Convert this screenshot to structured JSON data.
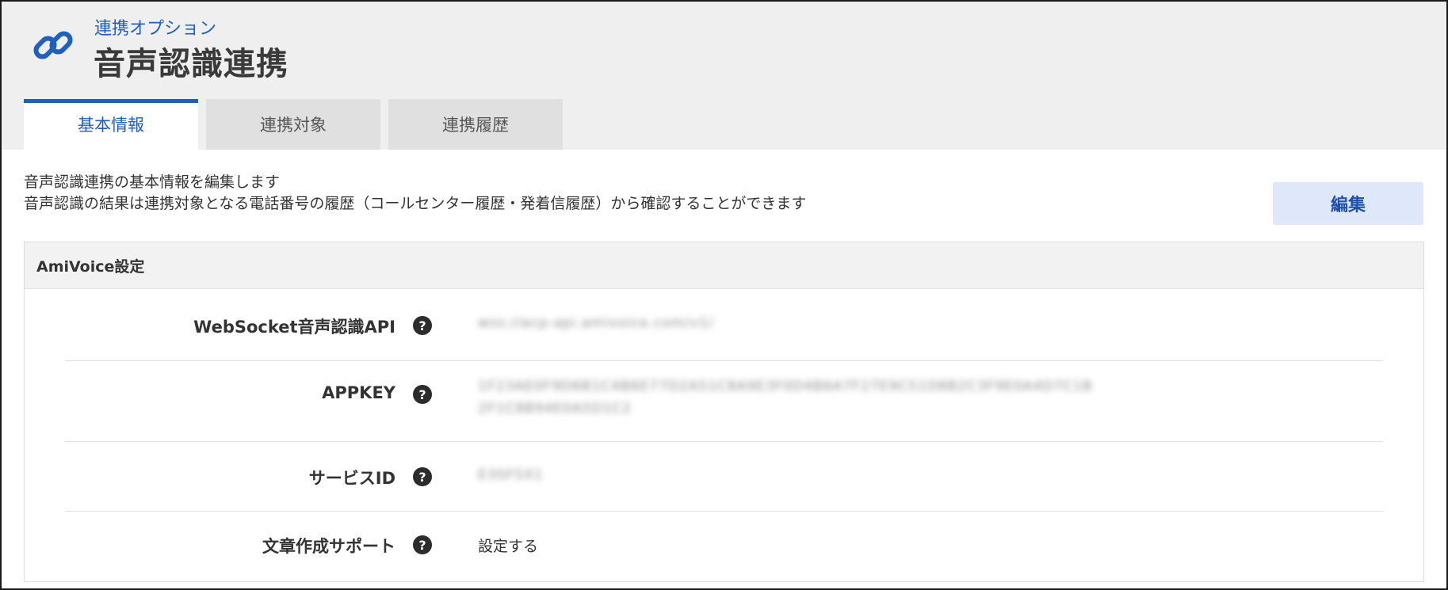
{
  "header": {
    "subtitle": "連携オプション",
    "title": "音声認識連携",
    "icon": "link-icon",
    "accent_color": "#1f5fbf"
  },
  "tabs": [
    {
      "label": "基本情報",
      "active": true
    },
    {
      "label": "連携対象",
      "active": false
    },
    {
      "label": "連携履歴",
      "active": false
    }
  ],
  "description": {
    "line1": "音声認識連携の基本情報を編集します",
    "line2": "音声認識の結果は連携対象となる電話番号の履歴（コールセンター履歴・発着信履歴）から確認することができます"
  },
  "edit_button": {
    "label": "編集"
  },
  "panel": {
    "title": "AmiVoice設定",
    "rows": [
      {
        "label": "WebSocket音声認識API",
        "help_icon": "question-circle-icon",
        "value": "wss://acp-api.amivoice.com/v1/",
        "blurred": true
      },
      {
        "label": "APPKEY",
        "help_icon": "question-circle-icon",
        "value": "1F23AE0F9D6B1C4B6E77D2A51C8A9E3F0D4B6A7F27E9C51D8B2C3F9E0A4D7C1B",
        "value2": "2F1C8B94E0A5D1C2",
        "blurred": true
      },
      {
        "label": "サービスID",
        "help_icon": "question-circle-icon",
        "value": "E3SF5X1",
        "blurred": true
      },
      {
        "label": "文章作成サポート",
        "help_icon": "question-circle-icon",
        "value": "設定する",
        "blurred": false
      }
    ]
  }
}
